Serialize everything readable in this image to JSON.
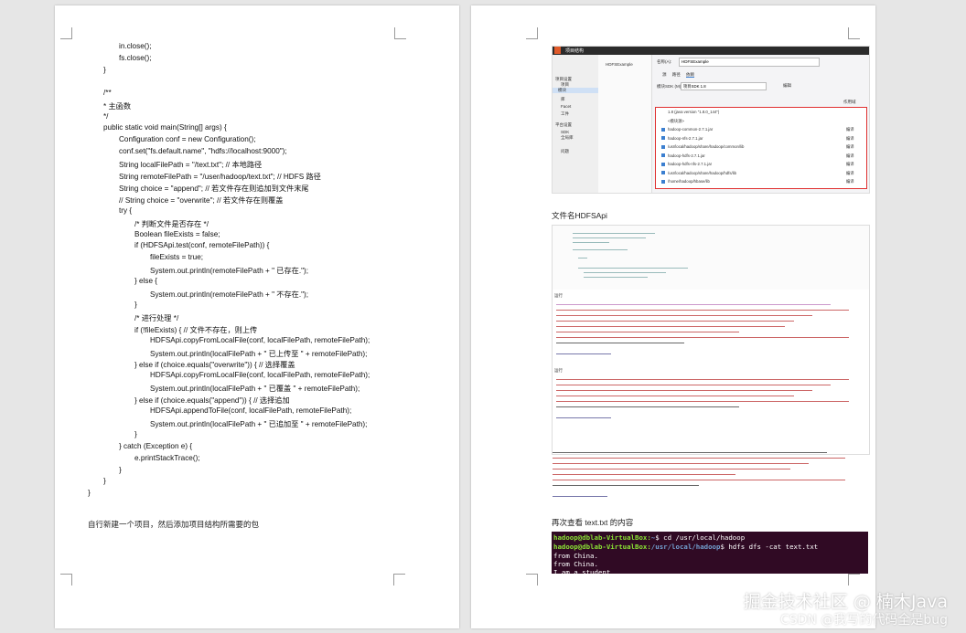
{
  "page1": {
    "code_lines": [
      "in.close();",
      "fs.close();",
      "}",
      "/**",
      " * 主函数",
      " */",
      "public static void main(String[] args) {",
      "Configuration conf = new Configuration();",
      "conf.set(\"fs.default.name\", \"hdfs://localhost:9000\");",
      "String localFilePath = \"/text.txt\"; // 本地路径",
      "String remoteFilePath = \"/user/hadoop/text.txt\"; // HDFS 路径",
      "String choice = \"append\"; // 若文件存在则追加到文件末尾",
      "// String choice = \"overwrite\"; // 若文件存在则覆盖",
      "try {",
      "/* 判断文件是否存在 */",
      "Boolean fileExists = false;",
      "if (HDFSApi.test(conf, remoteFilePath)) {",
      "fileExists = true;",
      "System.out.println(remoteFilePath + \" 已存在.\");",
      "} else {",
      "System.out.println(remoteFilePath + \" 不存在.\");",
      "}",
      "/* 进行处理 */",
      "if (!fileExists) { // 文件不存在，则上传",
      "HDFSApi.copyFromLocalFile(conf, localFilePath, remoteFilePath);",
      "System.out.println(localFilePath + \" 已上传至 \" + remoteFilePath);",
      "} else if (choice.equals(\"overwrite\")) { // 选择覆盖",
      "HDFSApi.copyFromLocalFile(conf, localFilePath, remoteFilePath);",
      "System.out.println(localFilePath + \" 已覆盖 \" + remoteFilePath);",
      "} else if (choice.equals(\"append\")) { // 选择追加",
      "HDFSApi.appendToFile(conf, localFilePath, remoteFilePath);",
      "System.out.println(localFilePath + \" 已追加至 \" + remoteFilePath);",
      "}",
      "} catch (Exception e) {",
      "e.printStackTrace();",
      "}",
      "}",
      "}"
    ],
    "footer_text": "自行新建一个项目，然后添加项目结构所需要的包"
  },
  "page2": {
    "dialog": {
      "title": "项目结构",
      "name_label": "名称(A):",
      "name_value": "HDFSExample",
      "module_name": "HDFSExample",
      "tabs": [
        "源",
        "路径",
        "依赖"
      ],
      "sdk_label": "模块SDK (M):",
      "sdk_value": "项目SDK 1.8",
      "edit_label": "编辑",
      "scope_label": "作用域",
      "sidebar_sections": [
        "项目设置",
        "项目",
        "模块",
        "库",
        "Facet",
        "工件",
        "平台设置",
        "SDK",
        "全局库",
        "问题"
      ],
      "deps": [
        "1.8 (java version \"1.8.0_144\")",
        "<模块源>",
        "hadoop-common-2.7.1.jar",
        "hadoop-nfs-2.7.1.jar",
        "/usr/local/hadoop/share/hadoop/common/lib",
        "hadoop-hdfs-2.7.1.jar",
        "hadoop-hdfs-nfs-2.7.1.jar",
        "/usr/local/hadoop/share/hadoop/hdfs/lib",
        "/home/hadoop/hbase/lib"
      ],
      "scope_value": "编译"
    },
    "filename_label": "文件名HDFSApi",
    "run_label": "运行",
    "recheck_label": "再次查看 text.txt 的内容",
    "terminal": {
      "line1_prompt": "hadoop@dblab-VirtualBox:",
      "line1_path": "~",
      "line1_cmd": "$ cd /usr/local/hadoop",
      "line2_prompt": "hadoop@dblab-VirtualBox:",
      "line2_path": "/usr/local/hadoop",
      "line2_cmd": "$ hdfs dfs -cat text.txt",
      "out1": " from China.",
      "out2": " from China.",
      "out3": "I am a student"
    }
  },
  "watermark": {
    "line1": "掘金技术社区 @ 楠木Java",
    "line2": "CSDN @我写的代码全是bug"
  }
}
